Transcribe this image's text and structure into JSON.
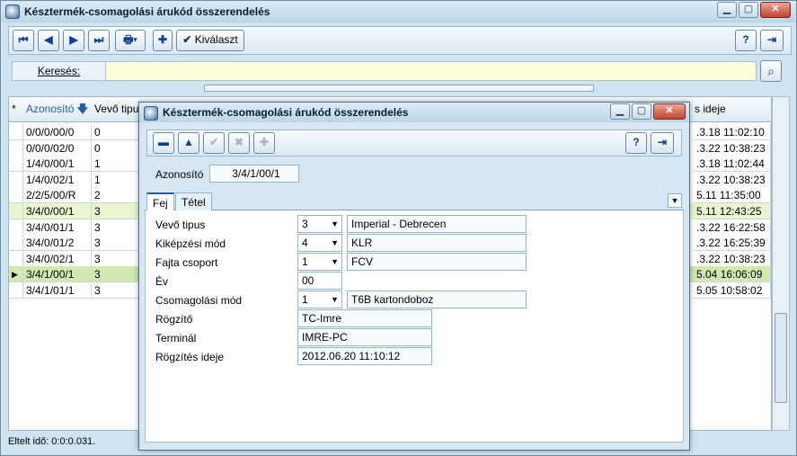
{
  "main": {
    "title": "Késztermék-csomagolási árukód összerendelés",
    "toolbar": {
      "select_label": "Kiválaszt"
    },
    "search_label": "Keresés:",
    "columns": [
      "*",
      "Azonosító",
      "Vevő tipus",
      "s ideje"
    ],
    "rows": [
      {
        "id": "0/0/0/00/0",
        "vevo": "0",
        "ido": ".3.18 11:02:10"
      },
      {
        "id": "0/0/0/02/0",
        "vevo": "0",
        "ido": ".3.22 10:38:23"
      },
      {
        "id": "1/4/0/00/1",
        "vevo": "1",
        "ido": ".3.18 11:02:44"
      },
      {
        "id": "1/4/0/02/1",
        "vevo": "1",
        "ido": ".3.22 10:38:23"
      },
      {
        "id": "2/2/5/00/R",
        "vevo": "2",
        "ido": "5.11 11:35:00"
      },
      {
        "id": "3/4/0/00/1",
        "vevo": "3",
        "ido": "5.11 12:43:25"
      },
      {
        "id": "3/4/0/01/1",
        "vevo": "3",
        "ido": ".3.22 16:22:58"
      },
      {
        "id": "3/4/0/01/2",
        "vevo": "3",
        "ido": ".3.22 16:25:39"
      },
      {
        "id": "3/4/0/02/1",
        "vevo": "3",
        "ido": ".3.22 10:38:23"
      },
      {
        "id": "3/4/1/00/1",
        "vevo": "3",
        "ido": "5.04 16:06:09"
      },
      {
        "id": "3/4/1/01/1",
        "vevo": "3",
        "ido": "5.05 10:58:02"
      }
    ],
    "status": "Eltelt idő: 0:0:0.031."
  },
  "dialog": {
    "title": "Késztermék-csomagolási árukód összerendelés",
    "id_label": "Azonosító",
    "id_value": "3/4/1/00/1",
    "tabs": [
      "Fej",
      "Tétel"
    ],
    "fields": {
      "vevo_label": "Vevő tipus",
      "vevo_code": "3",
      "vevo_name": "Imperial - Debrecen",
      "kepz_label": "Kiképzési mód",
      "kepz_code": "4",
      "kepz_name": "KLR",
      "fajta_label": "Fajta csoport",
      "fajta_code": "1",
      "fajta_name": "FCV",
      "ev_label": "Év",
      "ev_value": "00",
      "csom_label": "Csomagolási mód",
      "csom_code": "1",
      "csom_name": "T6B kartondoboz",
      "rogzito_label": "Rögzítő",
      "rogzito_value": "TC-Imre",
      "terminal_label": "Terminál",
      "terminal_value": "IMRE-PC",
      "rogz_ido_label": "Rögzítés ideje",
      "rogz_ido_value": "2012.06.20 11:10:12"
    }
  },
  "colors": {
    "highlight_row": "#e8f5cf",
    "selected_row": "#cfe9b0",
    "accent": "#1e5ea8"
  }
}
